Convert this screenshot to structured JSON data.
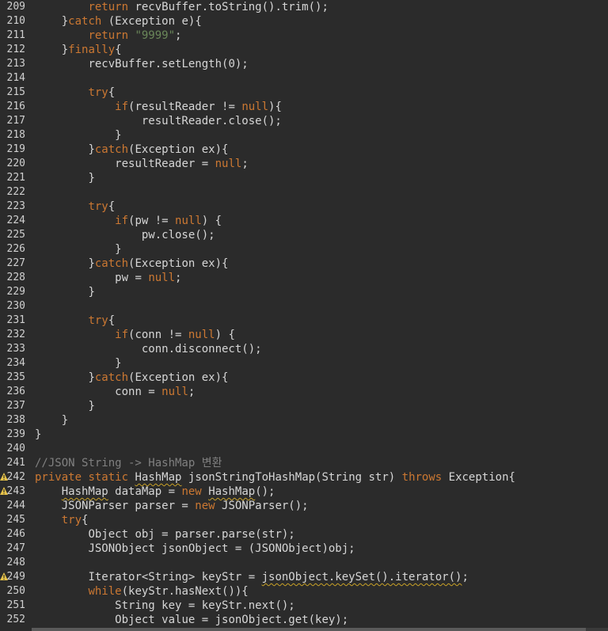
{
  "editor": {
    "lines": [
      {
        "n": "209",
        "warn": false,
        "indent": "        ",
        "tokens": [
          [
            "kw",
            "return"
          ],
          [
            "txt",
            " recvBuffer.toString().trim();"
          ]
        ]
      },
      {
        "n": "210",
        "warn": false,
        "indent": "    ",
        "tokens": [
          [
            "txt",
            "}"
          ],
          [
            "kw",
            "catch"
          ],
          [
            "txt",
            " (Exception e){"
          ]
        ]
      },
      {
        "n": "211",
        "warn": false,
        "indent": "        ",
        "tokens": [
          [
            "kw",
            "return"
          ],
          [
            "txt",
            " "
          ],
          [
            "str",
            "\"9999\""
          ],
          [
            "txt",
            ";"
          ]
        ]
      },
      {
        "n": "212",
        "warn": false,
        "indent": "    ",
        "tokens": [
          [
            "txt",
            "}"
          ],
          [
            "kw",
            "finally"
          ],
          [
            "txt",
            "{"
          ]
        ]
      },
      {
        "n": "213",
        "warn": false,
        "indent": "        ",
        "tokens": [
          [
            "txt",
            "recvBuffer.setLength(0);"
          ]
        ]
      },
      {
        "n": "214",
        "warn": false,
        "indent": "",
        "tokens": []
      },
      {
        "n": "215",
        "warn": false,
        "indent": "        ",
        "tokens": [
          [
            "kw",
            "try"
          ],
          [
            "txt",
            "{"
          ]
        ]
      },
      {
        "n": "216",
        "warn": false,
        "indent": "            ",
        "tokens": [
          [
            "kw",
            "if"
          ],
          [
            "txt",
            "(resultReader != "
          ],
          [
            "kw",
            "null"
          ],
          [
            "txt",
            "){"
          ]
        ]
      },
      {
        "n": "217",
        "warn": false,
        "indent": "                ",
        "tokens": [
          [
            "txt",
            "resultReader.close();"
          ]
        ]
      },
      {
        "n": "218",
        "warn": false,
        "indent": "            ",
        "tokens": [
          [
            "txt",
            "}"
          ]
        ]
      },
      {
        "n": "219",
        "warn": false,
        "indent": "        ",
        "tokens": [
          [
            "txt",
            "}"
          ],
          [
            "kw",
            "catch"
          ],
          [
            "txt",
            "(Exception ex){"
          ]
        ]
      },
      {
        "n": "220",
        "warn": false,
        "indent": "            ",
        "tokens": [
          [
            "txt",
            "resultReader = "
          ],
          [
            "kw",
            "null"
          ],
          [
            "txt",
            ";"
          ]
        ]
      },
      {
        "n": "221",
        "warn": false,
        "indent": "        ",
        "tokens": [
          [
            "txt",
            "}"
          ]
        ]
      },
      {
        "n": "222",
        "warn": false,
        "indent": "",
        "tokens": []
      },
      {
        "n": "223",
        "warn": false,
        "indent": "        ",
        "tokens": [
          [
            "kw",
            "try"
          ],
          [
            "txt",
            "{"
          ]
        ]
      },
      {
        "n": "224",
        "warn": false,
        "indent": "            ",
        "tokens": [
          [
            "kw",
            "if"
          ],
          [
            "txt",
            "(pw != "
          ],
          [
            "kw",
            "null"
          ],
          [
            "txt",
            ") {"
          ]
        ]
      },
      {
        "n": "225",
        "warn": false,
        "indent": "                ",
        "tokens": [
          [
            "txt",
            "pw.close();"
          ]
        ]
      },
      {
        "n": "226",
        "warn": false,
        "indent": "            ",
        "tokens": [
          [
            "txt",
            "}"
          ]
        ]
      },
      {
        "n": "227",
        "warn": false,
        "indent": "        ",
        "tokens": [
          [
            "txt",
            "}"
          ],
          [
            "kw",
            "catch"
          ],
          [
            "txt",
            "(Exception ex){"
          ]
        ]
      },
      {
        "n": "228",
        "warn": false,
        "indent": "            ",
        "tokens": [
          [
            "txt",
            "pw = "
          ],
          [
            "kw",
            "null"
          ],
          [
            "txt",
            ";"
          ]
        ]
      },
      {
        "n": "229",
        "warn": false,
        "indent": "        ",
        "tokens": [
          [
            "txt",
            "}"
          ]
        ]
      },
      {
        "n": "230",
        "warn": false,
        "indent": "",
        "tokens": []
      },
      {
        "n": "231",
        "warn": false,
        "indent": "        ",
        "tokens": [
          [
            "kw",
            "try"
          ],
          [
            "txt",
            "{"
          ]
        ]
      },
      {
        "n": "232",
        "warn": false,
        "indent": "            ",
        "tokens": [
          [
            "kw",
            "if"
          ],
          [
            "txt",
            "(conn != "
          ],
          [
            "kw",
            "null"
          ],
          [
            "txt",
            ") {"
          ]
        ]
      },
      {
        "n": "233",
        "warn": false,
        "indent": "                ",
        "tokens": [
          [
            "txt",
            "conn.disconnect();"
          ]
        ]
      },
      {
        "n": "234",
        "warn": false,
        "indent": "            ",
        "tokens": [
          [
            "txt",
            "}"
          ]
        ]
      },
      {
        "n": "235",
        "warn": false,
        "indent": "        ",
        "tokens": [
          [
            "txt",
            "}"
          ],
          [
            "kw",
            "catch"
          ],
          [
            "txt",
            "(Exception ex){"
          ]
        ]
      },
      {
        "n": "236",
        "warn": false,
        "indent": "            ",
        "tokens": [
          [
            "txt",
            "conn = "
          ],
          [
            "kw",
            "null"
          ],
          [
            "txt",
            ";"
          ]
        ]
      },
      {
        "n": "237",
        "warn": false,
        "indent": "        ",
        "tokens": [
          [
            "txt",
            "}"
          ]
        ]
      },
      {
        "n": "238",
        "warn": false,
        "indent": "    ",
        "tokens": [
          [
            "txt",
            "}"
          ]
        ]
      },
      {
        "n": "239",
        "warn": false,
        "indent": "",
        "tokens": [
          [
            "txt",
            "}"
          ]
        ]
      },
      {
        "n": "240",
        "warn": false,
        "indent": "",
        "tokens": []
      },
      {
        "n": "241",
        "warn": false,
        "indent": "",
        "tokens": [
          [
            "cmt",
            "//JSON String -> HashMap 변환"
          ]
        ]
      },
      {
        "n": "242",
        "warn": true,
        "indent": "",
        "tokens": [
          [
            "kw",
            "private"
          ],
          [
            "txt",
            " "
          ],
          [
            "kw",
            "static"
          ],
          [
            "txt",
            " "
          ],
          [
            "squig",
            "HashMap"
          ],
          [
            "txt",
            " jsonStringToHashMap(String str) "
          ],
          [
            "kw",
            "throws"
          ],
          [
            "txt",
            " Exception{"
          ]
        ]
      },
      {
        "n": "243",
        "warn": true,
        "indent": "    ",
        "tokens": [
          [
            "squig",
            "HashMap"
          ],
          [
            "txt",
            " dataMap = "
          ],
          [
            "kw",
            "new"
          ],
          [
            "txt",
            " "
          ],
          [
            "squig",
            "HashMap"
          ],
          [
            "txt",
            "();"
          ]
        ]
      },
      {
        "n": "244",
        "warn": false,
        "indent": "    ",
        "tokens": [
          [
            "txt",
            "JSONParser parser = "
          ],
          [
            "kw",
            "new"
          ],
          [
            "txt",
            " JSONParser();"
          ]
        ]
      },
      {
        "n": "245",
        "warn": false,
        "indent": "    ",
        "tokens": [
          [
            "kw",
            "try"
          ],
          [
            "txt",
            "{"
          ]
        ]
      },
      {
        "n": "246",
        "warn": false,
        "indent": "        ",
        "tokens": [
          [
            "txt",
            "Object obj = parser.parse(str);"
          ]
        ]
      },
      {
        "n": "247",
        "warn": false,
        "indent": "        ",
        "tokens": [
          [
            "txt",
            "JSONObject jsonObject = (JSONObject)obj;"
          ]
        ]
      },
      {
        "n": "248",
        "warn": false,
        "indent": "",
        "tokens": []
      },
      {
        "n": "249",
        "warn": true,
        "indent": "        ",
        "tokens": [
          [
            "txt",
            "Iterator<String> keyStr = "
          ],
          [
            "squig",
            "jsonObject.keySet().iterator()"
          ],
          [
            "txt",
            ";"
          ]
        ]
      },
      {
        "n": "250",
        "warn": false,
        "indent": "        ",
        "tokens": [
          [
            "kw",
            "while"
          ],
          [
            "txt",
            "(keyStr.hasNext()){"
          ]
        ]
      },
      {
        "n": "251",
        "warn": false,
        "indent": "            ",
        "tokens": [
          [
            "txt",
            "String key = keyStr.next();"
          ]
        ]
      },
      {
        "n": "252",
        "warn": false,
        "indent": "            ",
        "tokens": [
          [
            "txt",
            "Object value = jsonObject.get(key);"
          ]
        ]
      }
    ]
  },
  "colors": {
    "background": "#2b2b2b",
    "keyword": "#cc7832",
    "string": "#6a8759",
    "comment": "#808080",
    "text": "#d6d6d6",
    "warning": "#e8c44a"
  },
  "icons": {
    "warning": "warning-triangle-icon"
  }
}
